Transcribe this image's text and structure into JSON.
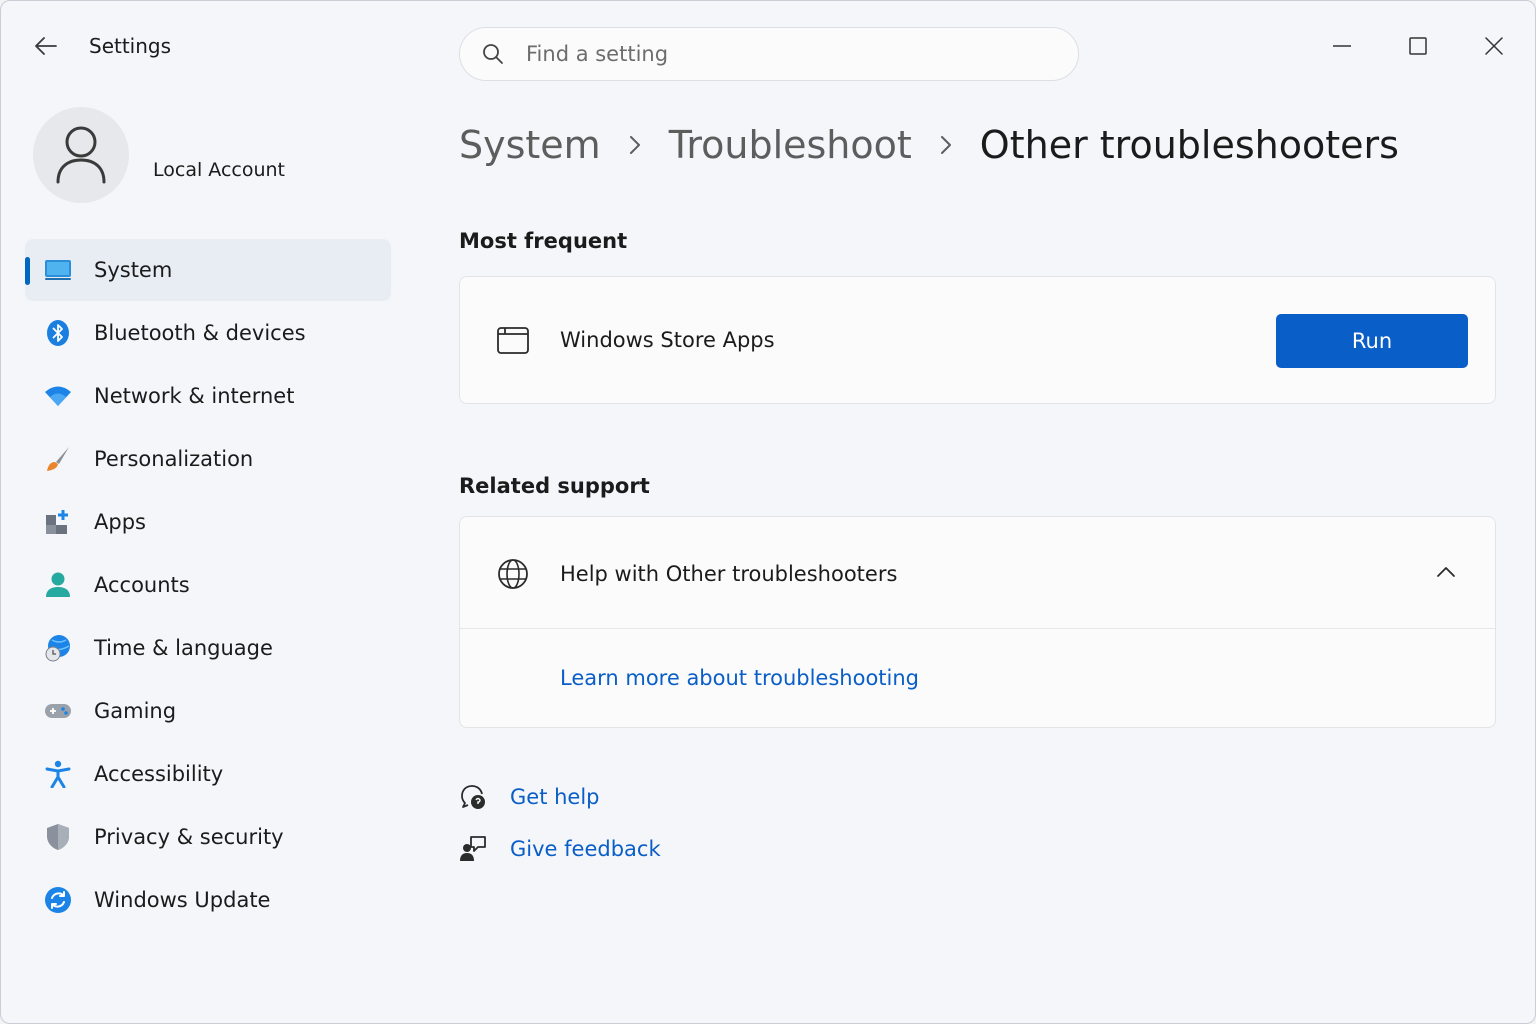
{
  "window": {
    "title": "Settings",
    "controls": {
      "minimize": "minimize-icon",
      "maximize": "maximize-icon",
      "close": "close-icon"
    }
  },
  "search": {
    "placeholder": "Find a setting",
    "value": ""
  },
  "profile": {
    "name": "Local Account"
  },
  "sidebar": {
    "items": [
      {
        "label": "System",
        "icon": "monitor-icon",
        "selected": true
      },
      {
        "label": "Bluetooth & devices",
        "icon": "bluetooth-icon"
      },
      {
        "label": "Network & internet",
        "icon": "wifi-icon"
      },
      {
        "label": "Personalization",
        "icon": "brush-icon"
      },
      {
        "label": "Apps",
        "icon": "apps-icon"
      },
      {
        "label": "Accounts",
        "icon": "person-icon"
      },
      {
        "label": "Time & language",
        "icon": "globe-clock-icon"
      },
      {
        "label": "Gaming",
        "icon": "gamepad-icon"
      },
      {
        "label": "Accessibility",
        "icon": "accessibility-icon"
      },
      {
        "label": "Privacy & security",
        "icon": "shield-icon"
      },
      {
        "label": "Windows Update",
        "icon": "update-icon"
      }
    ]
  },
  "breadcrumb": [
    "System",
    "Troubleshoot",
    "Other troubleshooters"
  ],
  "most_frequent": {
    "title": "Most frequent",
    "item": {
      "label": "Windows Store Apps",
      "icon": "store-window-icon",
      "button": "Run"
    }
  },
  "related_support": {
    "title": "Related support",
    "header": "Help with Other troubleshooters",
    "expanded": true,
    "link": "Learn more about troubleshooting"
  },
  "footer": {
    "get_help": "Get help",
    "give_feedback": "Give feedback"
  },
  "colors": {
    "accent": "#0a5ec7",
    "selected_bg": "#e8edf4",
    "indicator": "#0067c0"
  }
}
